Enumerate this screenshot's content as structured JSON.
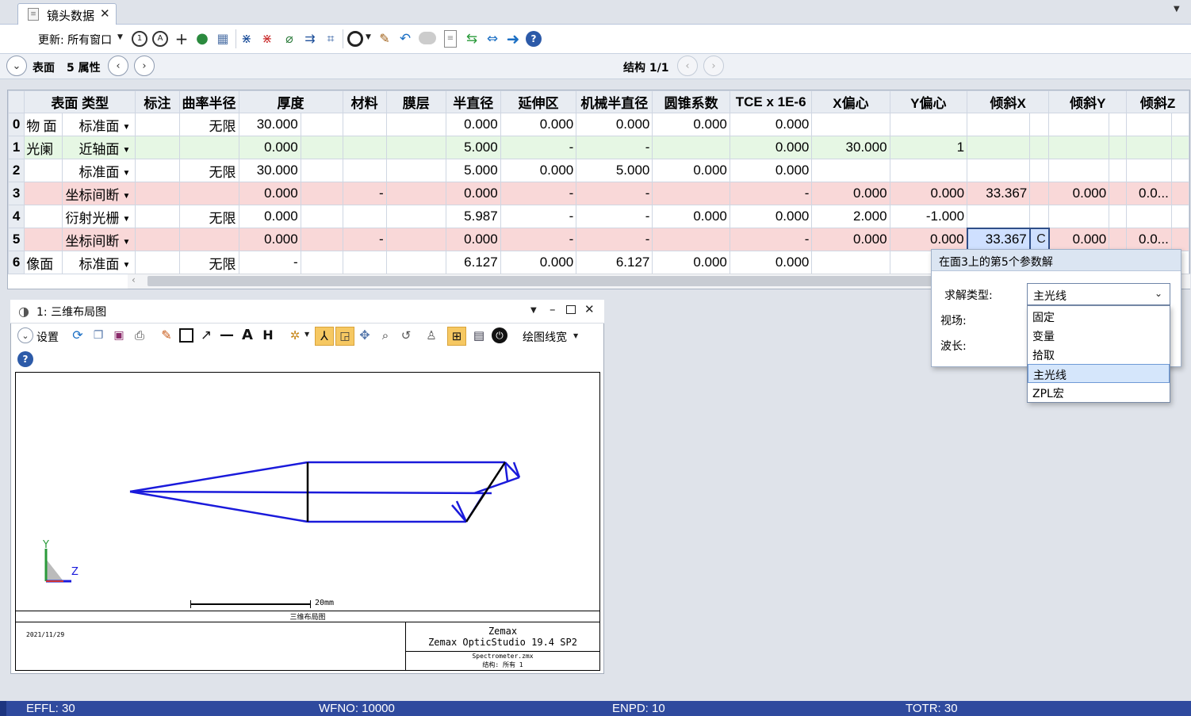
{
  "tab": {
    "title": "镜头数据",
    "close": "✕"
  },
  "toolbar": {
    "update_label": "更新: 所有窗口"
  },
  "nav": {
    "surface_label": "表面",
    "props_label": "5 属性",
    "config_label": "结构 1/1"
  },
  "grid": {
    "headers": [
      "表面 类型",
      "标注",
      "曲率半径",
      "厚度",
      "材料",
      "膜层",
      "半直径",
      "延伸区",
      "机械半直径",
      "圆锥系数",
      "TCE x 1E-6",
      "X偏心",
      "Y偏心",
      "倾斜X",
      "倾斜Y",
      "倾斜Z"
    ],
    "rows": [
      {
        "idx": "0",
        "comment": "物 面",
        "type": "标准面",
        "radius": "无限",
        "thickness": "30.000",
        "material": "",
        "coating": "",
        "semi": "0.000",
        "chip": "0.000",
        "mech": "0.000",
        "conic": "0.000",
        "tce": "0.000",
        "xdec": "",
        "ydec": "",
        "tiltx": "",
        "tilty": "",
        "tiltz": ""
      },
      {
        "idx": "1",
        "comment": "光阑",
        "type": "近轴面",
        "radius": "",
        "thickness": "0.000",
        "material": "",
        "coating": "",
        "semi": "5.000",
        "chip": "-",
        "mech": "-",
        "conic": "",
        "tce": "0.000",
        "xdec": "30.000",
        "ydec": "1",
        "tiltx": "",
        "tilty": "",
        "tiltz": ""
      },
      {
        "idx": "2",
        "comment": "",
        "type": "标准面",
        "radius": "无限",
        "thickness": "30.000",
        "material": "",
        "coating": "",
        "semi": "5.000",
        "chip": "0.000",
        "mech": "5.000",
        "conic": "0.000",
        "tce": "0.000",
        "xdec": "",
        "ydec": "",
        "tiltx": "",
        "tilty": "",
        "tiltz": ""
      },
      {
        "idx": "3",
        "comment": "",
        "type": "坐标间断",
        "radius": "",
        "thickness": "0.000",
        "material": "-",
        "coating": "",
        "semi": "0.000",
        "chip": "-",
        "mech": "-",
        "conic": "",
        "tce": "-",
        "xdec": "0.000",
        "ydec": "0.000",
        "tiltx": "33.367",
        "tilty": "0.000",
        "tiltz": "0.0..."
      },
      {
        "idx": "4",
        "comment": "",
        "type": "衍射光栅",
        "radius": "无限",
        "thickness": "0.000",
        "material": "",
        "coating": "",
        "semi": "5.987",
        "chip": "-",
        "mech": "-",
        "conic": "0.000",
        "tce": "0.000",
        "xdec": "2.000",
        "ydec": "-1.000",
        "tiltx": "",
        "tilty": "",
        "tiltz": ""
      },
      {
        "idx": "5",
        "comment": "",
        "type": "坐标间断",
        "radius": "",
        "thickness": "0.000",
        "material": "-",
        "coating": "",
        "semi": "0.000",
        "chip": "-",
        "mech": "-",
        "conic": "",
        "tce": "-",
        "xdec": "0.000",
        "ydec": "0.000",
        "tiltx": "33.367",
        "tilty": "0.000",
        "tiltz": "0.0...",
        "solve": "C"
      },
      {
        "idx": "6",
        "comment": "像面",
        "type": "标准面",
        "radius": "无限",
        "thickness": "-",
        "material": "",
        "coating": "",
        "semi": "6.127",
        "chip": "0.000",
        "mech": "6.127",
        "conic": "0.000",
        "tce": "0.000",
        "xdec": "",
        "ydec": "",
        "tiltx": "",
        "tilty": "",
        "tiltz": ""
      }
    ]
  },
  "layout_window": {
    "title": "1: 三维布局图",
    "settings_label": "设置",
    "line_width_label": "绘图线宽",
    "axis_y": "Y",
    "axis_z": "Z",
    "scale_label": "20mm",
    "caption": "三维布局图",
    "date": "2021/11/29",
    "company": "Zemax",
    "product": "Zemax OpticStudio 19.4 SP2",
    "file": "Spectrometer.zmx",
    "config": "结构: 所有 1"
  },
  "solve_dialog": {
    "title": "在面3上的第5个参数解",
    "solve_type_label": "求解类型:",
    "field_label": "视场:",
    "wave_label": "波长:",
    "selected": "主光线",
    "options": [
      "固定",
      "变量",
      "拾取",
      "主光线",
      "ZPL宏"
    ],
    "highlighted_index": 3
  },
  "status": {
    "effl": "EFFL: 30",
    "wfno": "WFNO: 10000",
    "enpd": "ENPD: 10",
    "totr": "TOTR: 30"
  },
  "colors": {
    "ray": "#1a1adb",
    "status_bg": "#2f4a9e",
    "row_green": "#e6f7e4",
    "row_pink": "#f9d8d8"
  }
}
